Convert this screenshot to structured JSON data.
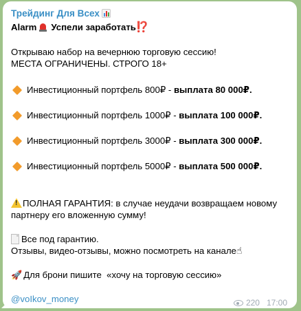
{
  "post": {
    "channel_name": "Трейдинг Для Всех",
    "headline": {
      "prefix": "Alarm",
      "text": "Успели заработать",
      "suffix": "⁉️"
    },
    "intro": "Открываю набор на вечернюю торговую сессию! МЕСТА ОГРАНИЧЕНЫ. СТРОГО 18+",
    "portfolios": [
      {
        "label": "Инвестиционный портфель 800₽ - ",
        "payout": "выплата 80 000₽."
      },
      {
        "label": "Инвестиционный портфель 1000₽ - ",
        "payout": "выплата 100 000₽."
      },
      {
        "label": "Инвестиционный портфель 3000₽ - ",
        "payout": "выплата 300 000₽."
      },
      {
        "label": "Инвестиционный портфель 5000₽ - ",
        "payout": "выплата 500 000₽."
      }
    ],
    "guarantee": "ПОЛНАЯ ГАРАНТИЯ: в случае неудачи возвращаем новому партнеру его вложенную сумму!",
    "under_guarantee": "Все под гарантию.",
    "reviews": "Отзывы, видео-отзывы, можно посмотреть на канале",
    "booking": "Для брони пишите  «хочу на торговую сессию»",
    "contact_link": "@voIkov_money",
    "views": "220",
    "time": "17:00",
    "icons": [
      "bar-chart-icon",
      "siren-icon",
      "orange-diamond-icon",
      "warning-icon",
      "page-icon",
      "pointing-hand-icon",
      "rocket-icon",
      "eye-icon"
    ],
    "colors": {
      "background": "#9fc38a",
      "link": "#3a8fc5",
      "accent_orange": "#f29b2b",
      "alarm_red": "#e0302a"
    }
  }
}
